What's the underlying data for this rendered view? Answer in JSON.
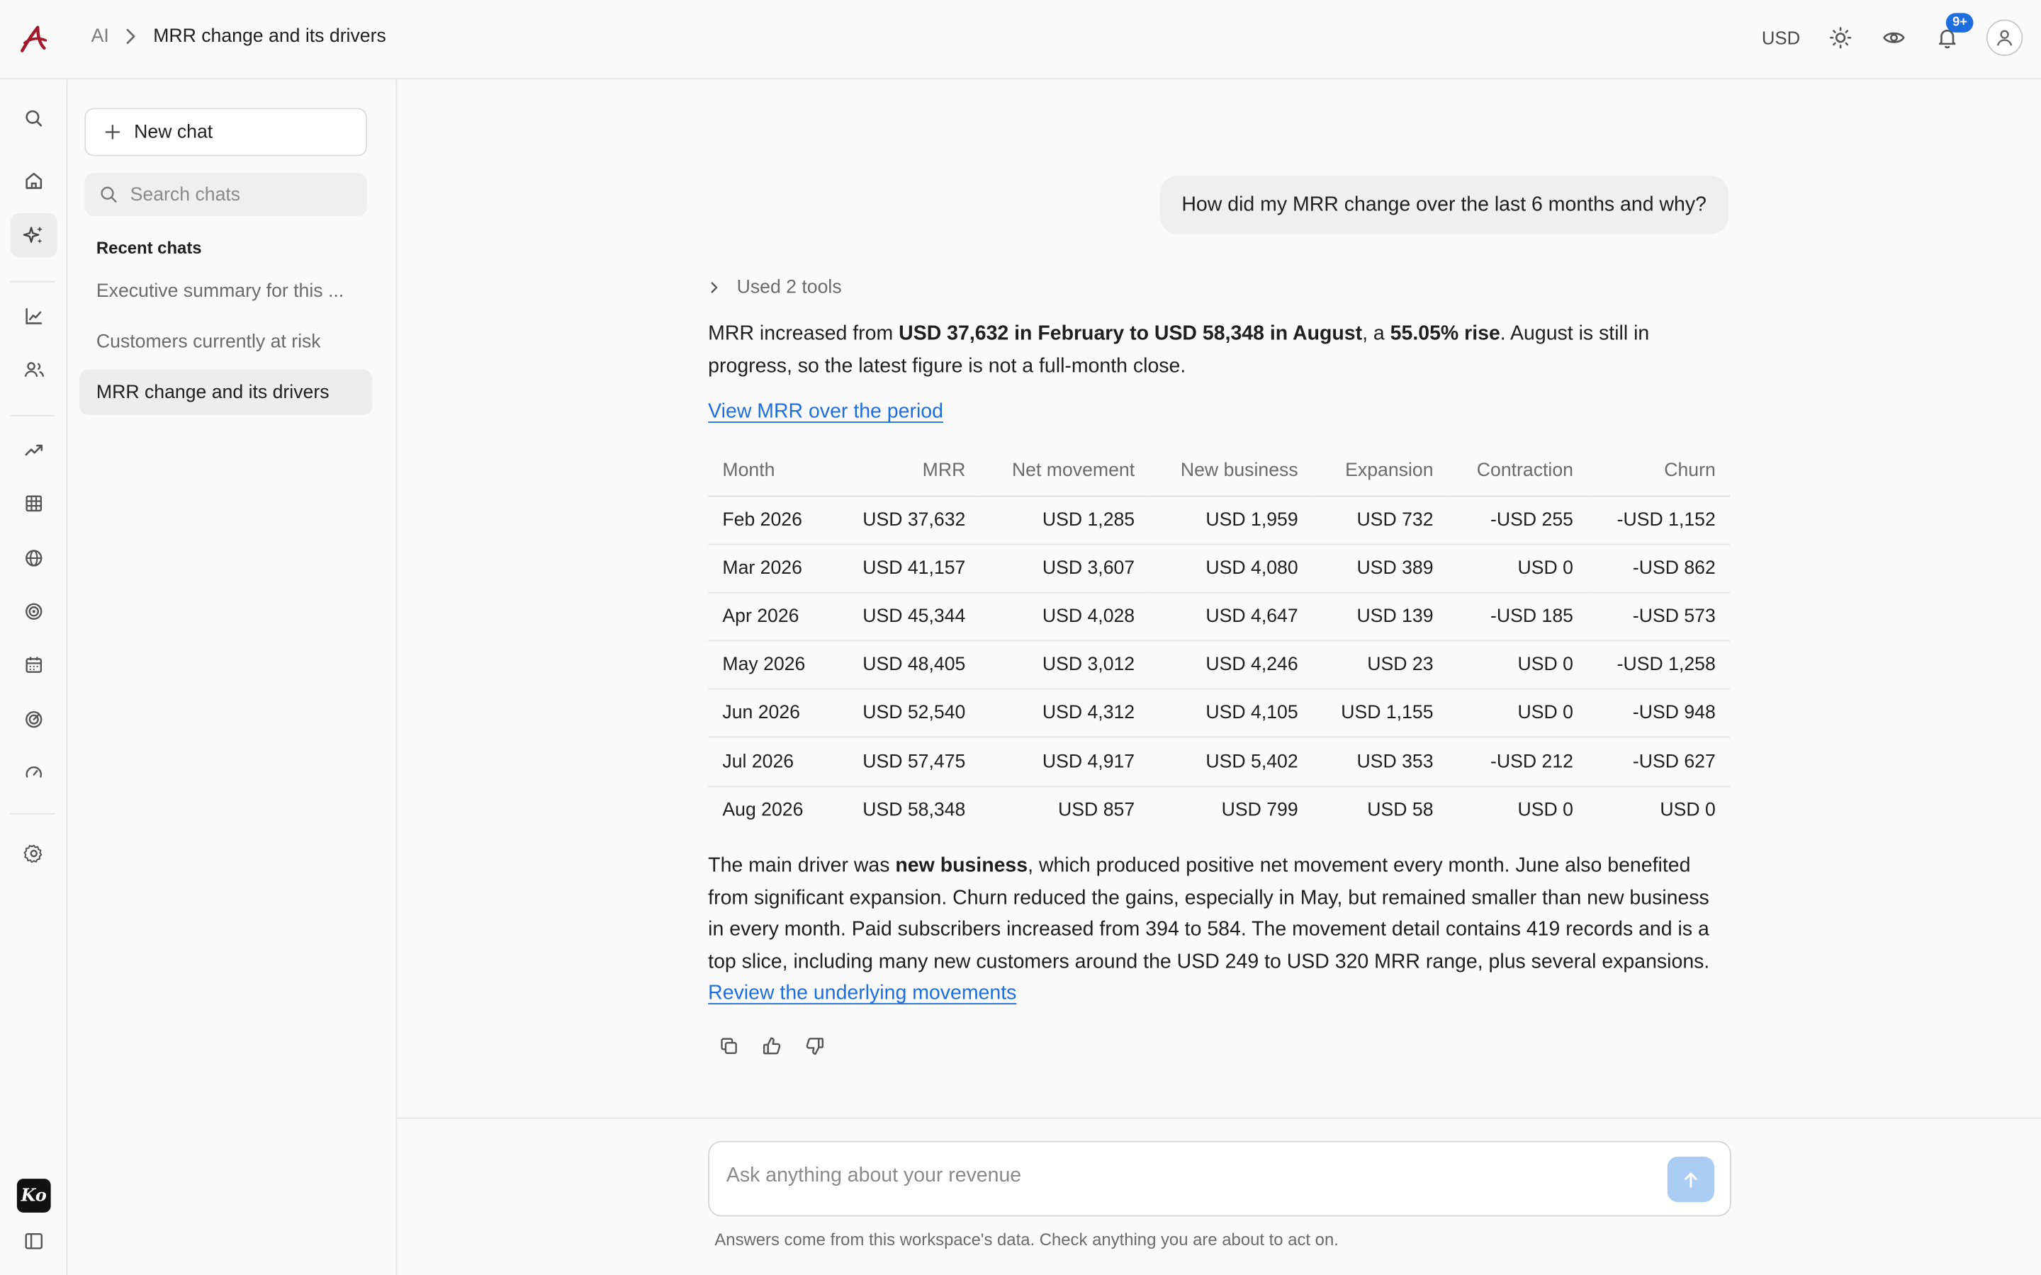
{
  "header": {
    "breadcrumb_root": "AI",
    "breadcrumb_current": "MRR change and its drivers",
    "currency": "USD",
    "notification_count": "9+"
  },
  "rail": {
    "icons": [
      "search-icon",
      "home-icon",
      "ai-sparkle-icon",
      "chart-icon",
      "users-icon",
      "trend-icon",
      "table-icon",
      "globe-icon",
      "target-icon",
      "calendar-icon",
      "radar-icon",
      "gauge-icon",
      "gear-icon",
      "sidebar-toggle-icon"
    ],
    "workspace_logo": "Ko"
  },
  "chats": {
    "new_chat_label": "New chat",
    "search_placeholder": "Search chats",
    "recent_heading": "Recent chats",
    "items": [
      {
        "label": "Executive summary for this ..."
      },
      {
        "label": "Customers currently at risk"
      },
      {
        "label": "MRR change and its drivers"
      }
    ]
  },
  "conversation": {
    "user_message": "How did my MRR change over the last 6 months and why?",
    "tools_label": "Used 2 tools",
    "intro": {
      "t1": "MRR increased from ",
      "b1": "USD 37,632 in February to USD 58,348 in August",
      "t2": ", a ",
      "b2": "55.05% rise",
      "t3": ". August is still in progress, so the latest figure is not a full-month close."
    },
    "view_link": "View MRR over the period",
    "table": {
      "headers": [
        "Month",
        "MRR",
        "Net movement",
        "New business",
        "Expansion",
        "Contraction",
        "Churn"
      ],
      "rows": [
        [
          "Feb 2026",
          "USD 37,632",
          "USD 1,285",
          "USD 1,959",
          "USD 732",
          "-USD 255",
          "-USD 1,152"
        ],
        [
          "Mar 2026",
          "USD 41,157",
          "USD 3,607",
          "USD 4,080",
          "USD 389",
          "USD 0",
          "-USD 862"
        ],
        [
          "Apr 2026",
          "USD 45,344",
          "USD 4,028",
          "USD 4,647",
          "USD 139",
          "-USD 185",
          "-USD 573"
        ],
        [
          "May 2026",
          "USD 48,405",
          "USD 3,012",
          "USD 4,246",
          "USD 23",
          "USD 0",
          "-USD 1,258"
        ],
        [
          "Jun 2026",
          "USD 52,540",
          "USD 4,312",
          "USD 4,105",
          "USD 1,155",
          "USD 0",
          "-USD 948"
        ],
        [
          "Jul 2026",
          "USD 57,475",
          "USD 4,917",
          "USD 5,402",
          "USD 353",
          "-USD 212",
          "-USD 627"
        ],
        [
          "Aug 2026",
          "USD 58,348",
          "USD 857",
          "USD 799",
          "USD 58",
          "USD 0",
          "USD 0"
        ]
      ]
    },
    "summary": {
      "t1": "The main driver was ",
      "b1": "new business",
      "t2": ", which produced positive net movement every month. June also benefited from significant expansion. Churn reduced the gains, especially in May, but remained smaller than new business in every month. Paid subscribers increased from 394 to 584. The movement detail contains 419 records and is a top slice, including many new customers around the USD 249 to USD 320 MRR range, plus several expansions. ",
      "link": "Review the underlying movements"
    }
  },
  "composer": {
    "placeholder": "Ask anything about your revenue",
    "disclaimer": "Answers come from this workspace's data. Check anything you are about to act on."
  },
  "colors": {
    "accent": "#1d6fe0",
    "logo": "#a3192b",
    "send_button": "#a9cdf5"
  }
}
